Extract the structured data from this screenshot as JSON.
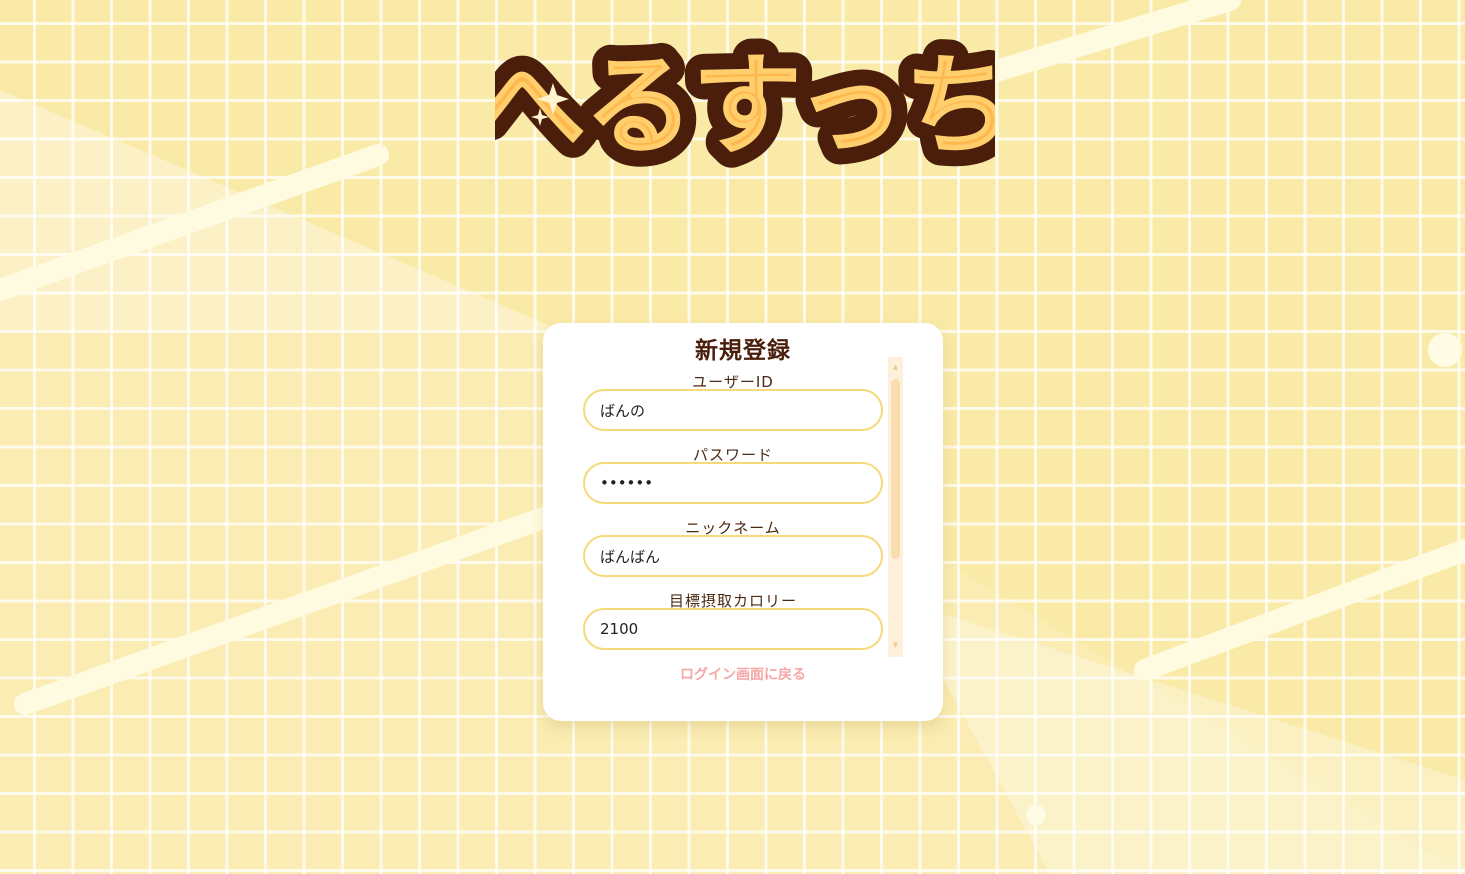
{
  "app": {
    "logo_text": "へるすっち"
  },
  "register": {
    "title": "新規登録",
    "fields": [
      {
        "label": "ユーザーID",
        "value": "ばんの",
        "type": "text"
      },
      {
        "label": "パスワード",
        "value": "••••••",
        "type": "password"
      },
      {
        "label": "ニックネーム",
        "value": "ばんばん",
        "type": "text"
      },
      {
        "label": "目標摂取カロリー",
        "value": "2100",
        "type": "text"
      }
    ],
    "back_link": "ログイン画面に戻る"
  },
  "colors": {
    "background": "#faeaa8",
    "logo_outline": "#4a1e0a",
    "logo_fill": "#ffb84d",
    "title": "#4a1e0a",
    "input_border": "#f5da7a",
    "back_link": "#f6a7a4"
  },
  "icons": {
    "scroll_up": "scroll-up-arrow-icon",
    "scroll_down": "scroll-down-arrow-icon",
    "sparkle": "sparkle-icon"
  }
}
